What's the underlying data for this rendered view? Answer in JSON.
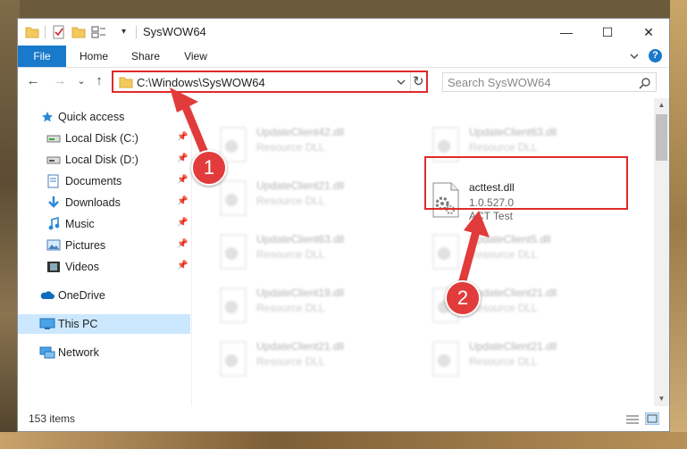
{
  "window": {
    "title": "SysWOW64",
    "minimize": "—",
    "maximize": "☐",
    "close": "✕"
  },
  "ribbon": {
    "tabs": [
      "File",
      "Home",
      "Share",
      "View"
    ],
    "expand_icon": "chevron-down-icon",
    "help_icon": "?"
  },
  "navigation": {
    "back": "←",
    "forward": "→",
    "recent": "⌄",
    "up": "↑",
    "address": "C:\\Windows\\SysWOW64",
    "refresh": "↻",
    "search_placeholder": "Search SysWOW64"
  },
  "sidebar": {
    "items": [
      {
        "label": "Quick access",
        "icon": "star-icon"
      },
      {
        "label": "Local Disk (C:)",
        "icon": "drive-icon",
        "pinned": true
      },
      {
        "label": "Local Disk (D:)",
        "icon": "drive-icon",
        "pinned": true
      },
      {
        "label": "Documents",
        "icon": "documents-icon",
        "pinned": true
      },
      {
        "label": "Downloads",
        "icon": "downloads-icon",
        "pinned": true
      },
      {
        "label": "Music",
        "icon": "music-icon",
        "pinned": true
      },
      {
        "label": "Pictures",
        "icon": "pictures-icon",
        "pinned": true
      },
      {
        "label": "Videos",
        "icon": "videos-icon",
        "pinned": true
      },
      {
        "label": "OneDrive",
        "icon": "cloud-icon"
      },
      {
        "label": "This PC",
        "icon": "computer-icon",
        "selected": true
      },
      {
        "label": "Network",
        "icon": "network-icon"
      }
    ]
  },
  "files": {
    "blurred": [
      {
        "name": "UpdateClient42.dll",
        "type": "Resource DLL"
      },
      {
        "name": "UpdateClient63.dll",
        "type": "Resource DLL"
      },
      {
        "name": "UpdateClient21.dll",
        "type": "Resource DLL"
      },
      {
        "name": "UpdateClient63.dll",
        "type": "Resource DLL"
      },
      {
        "name": "UpdateClient5.dll",
        "type": "Resource DLL"
      },
      {
        "name": "UpdateClient19.dll",
        "type": "Resource DLL"
      },
      {
        "name": "UpdateClient21.dll",
        "type": "Resource DLL"
      },
      {
        "name": "UpdateClient21.dll",
        "type": "Resource DLL"
      },
      {
        "name": "UpdateClient21.dll",
        "type": "Resource DLL"
      }
    ],
    "highlighted": {
      "name": "acttest.dll",
      "version": "1.0.527.0",
      "description": "ACT Test"
    }
  },
  "status": {
    "item_count": "153 items"
  },
  "callouts": [
    "1",
    "2"
  ],
  "colors": {
    "accent": "#1979ca",
    "highlight": "#e02a2a",
    "selected_bg": "#cce8ff"
  }
}
